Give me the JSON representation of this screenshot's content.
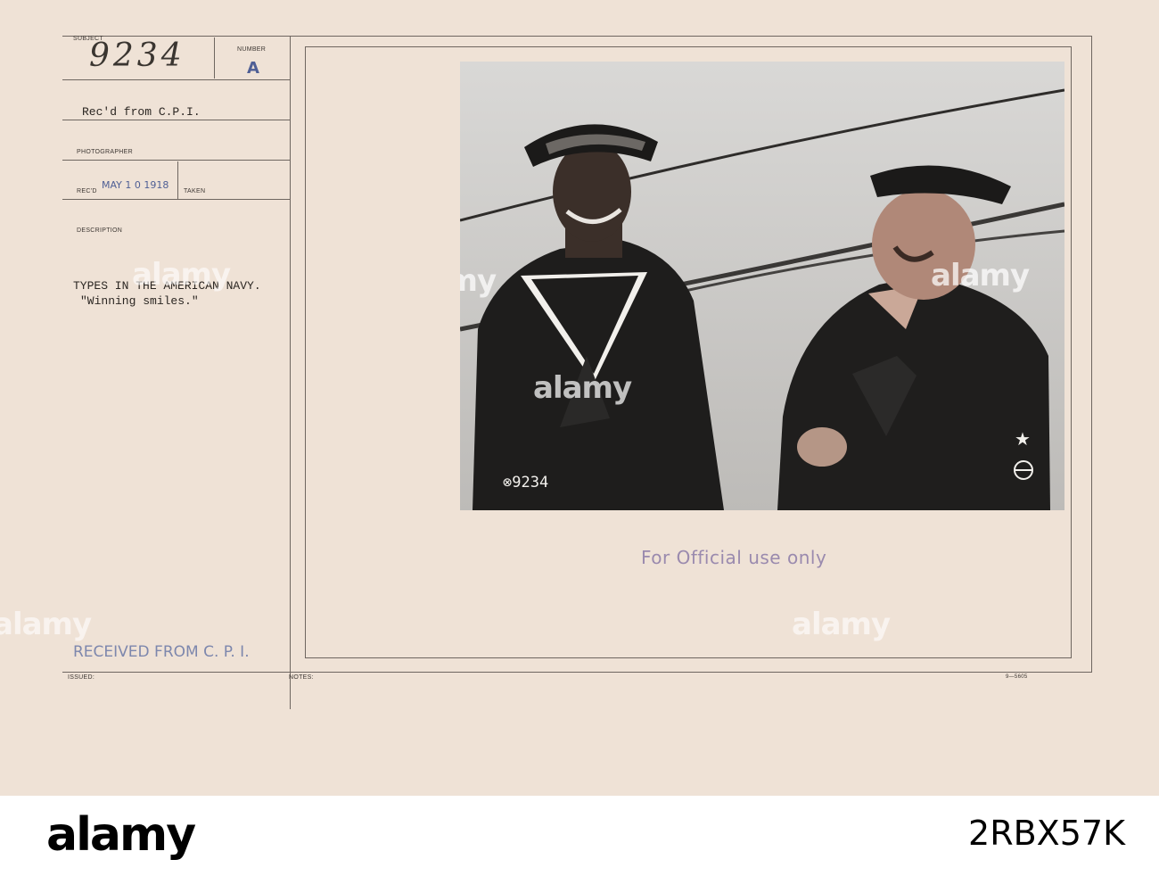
{
  "card": {
    "labels": {
      "subject": "SUBJECT",
      "number": "NUMBER",
      "photographer": "PHOTOGRAPHER",
      "recd": "REC'D",
      "taken": "TAKEN",
      "description": "DESCRIPTION",
      "issued": "ISSUED:",
      "notes": "NOTES:"
    },
    "subject_value": "9234",
    "number_value": "A",
    "recd_from": "Rec'd from C.P.I.",
    "recd_date": "MAY 1 0 1918",
    "description_line1": "TYPES IN THE AMERICAN NAVY.",
    "description_line2": "\"Winning smiles.\"",
    "received_stamp": "RECEIVED FROM C. P. I.",
    "photo_number": "⊗9234",
    "official_stamp": "For Official use only",
    "form_code": "9—5605"
  },
  "watermark": {
    "text": "alamy"
  },
  "footer": {
    "logo": "alamy",
    "image_id": "2RBX57K"
  }
}
